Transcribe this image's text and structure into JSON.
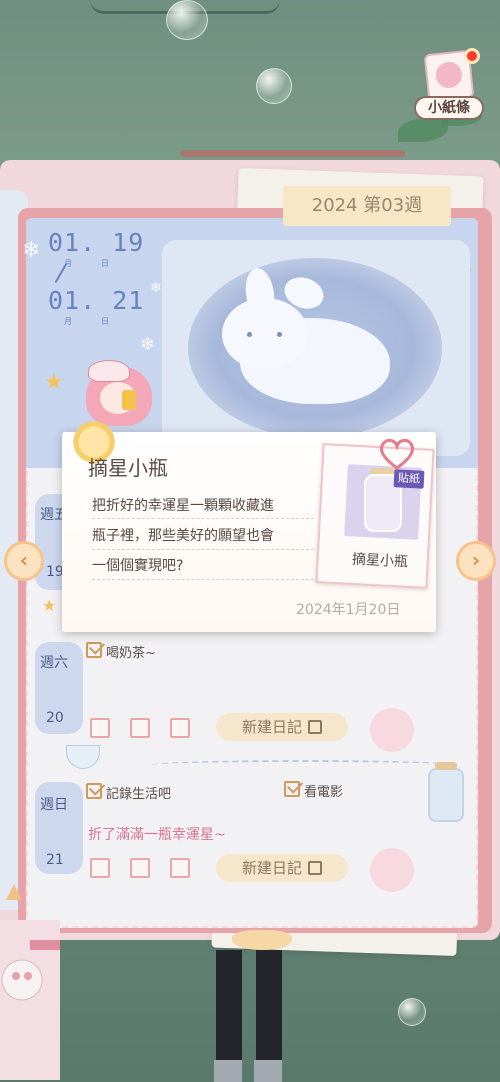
{
  "header": {
    "note_button_label": "小紙條"
  },
  "diary": {
    "week_tab": "2024 第03週",
    "date_range": {
      "start": {
        "day_text": "01. 19",
        "month_char": "月",
        "day_char": "日"
      },
      "end": {
        "day_text": "01. 21",
        "month_char": "月",
        "day_char": "日"
      }
    },
    "days": [
      {
        "label": "週五",
        "num": "19"
      },
      {
        "label": "週六",
        "num": "20",
        "entries": [
          "喝奶茶~"
        ],
        "new_diary_label": "新建日記"
      },
      {
        "label": "週日",
        "num": "21",
        "entries": [
          "記錄生活吧",
          "看電影"
        ],
        "note_red": "折了滿滿一瓶幸運星~",
        "new_diary_label": "新建日記"
      }
    ]
  },
  "popup": {
    "title": "摘星小瓶",
    "lines": [
      "把折好的幸運星一顆顆收藏進",
      "瓶子裡，那些美好的願望也會",
      "一個個實現吧?"
    ],
    "date": "2024年1月20日",
    "sticker": {
      "tag": "貼紙",
      "name": "摘星小瓶",
      "icon": "star-jar-icon"
    }
  },
  "nav": {
    "prev_icon": "chevron-left-icon",
    "next_icon": "chevron-right-icon"
  },
  "colors": {
    "accent_pink": "#e7a4a8",
    "date_blue": "#6882bd",
    "tab_beige": "#f8e6c6",
    "check_orange": "#cf9a5a"
  }
}
